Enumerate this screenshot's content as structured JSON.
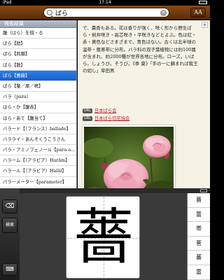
{
  "status": {
    "carrier": "iPad",
    "time": "17:14",
    "battery": ""
  },
  "search": {
    "value": "ばら",
    "placeholder": ""
  },
  "toolbar": {
    "font_size_label": "AA"
  },
  "sidebar": {
    "header": "検索結果",
    "items": [
      {
        "label": "腹（はら）を捌・る"
      },
      {
        "label": "ばら【肋】"
      },
      {
        "label": "ばら【荊棘】"
      },
      {
        "label": "ばら【散】"
      },
      {
        "label": "ばら【薔薇】",
        "selected": true
      },
      {
        "label": "ばら【輩／原／栲】"
      },
      {
        "label": "バラ（para）"
      },
      {
        "label": "はら・か【腹赤】"
      },
      {
        "label": "はら・あて【腹当て】"
      },
      {
        "label": "バラード【（フランス）ballade】"
      },
      {
        "label": "バラライ・あんそくうこうさん"
      },
      {
        "label": "パラ・アミノフェノール【para-a…"
      },
      {
        "label": "ハラーム【（アラビア）Ḥarām】"
      },
      {
        "label": "ハラール【（アラビア）Ḥalāl】"
      },
      {
        "label": "パラーメーター【parameter】"
      }
    ]
  },
  "detail": {
    "plus_label": "+",
    "body": "で、棗香もある。花は香りが強く、咲く形から野生ばら・剣弁咲き・高芯咲き・平咲きなどとよぶ。色は紅・赤・黄色などさまざまで、青色はない。古くは北半球の温帯・亜寒帯に分布。バラ科の双子葉植物には約100属が含まれ、約2000種が世界各地に分布。ローズ。いばら。しょうび。そうび。《季 夏》「手の一に蘇まれば我王の如し」草田男",
    "links": [
      {
        "badge": "URL",
        "text": "日本ばら会"
      },
      {
        "badge": "URL",
        "text": "日本ばら切花協会"
      }
    ]
  },
  "keyboard": {
    "backspace_label": "⌫",
    "search_label": "検索",
    "hide_label": "⌨",
    "handwriting": "薔",
    "candidates": [
      "薔",
      "蕾",
      "帯",
      "菅",
      "蕃",
      "雷"
    ]
  }
}
